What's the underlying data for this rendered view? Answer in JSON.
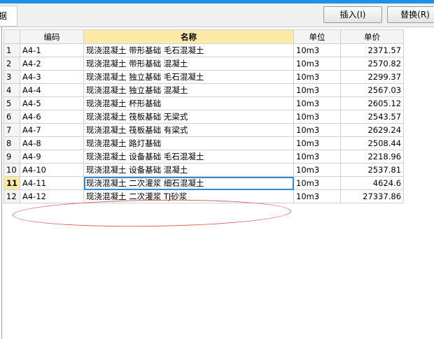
{
  "toolbar": {
    "partial_tab": "据",
    "insert_label": "插入(I)",
    "replace_label": "替换(R)"
  },
  "grid": {
    "columns": [
      "",
      "编码",
      "名称",
      "单位",
      "单价"
    ],
    "selected_row": 11,
    "rows": [
      {
        "num": "1",
        "code": "A4-1",
        "name": "现浇混凝土 带形基础 毛石混凝土",
        "unit": "10m3",
        "price": "2371.57"
      },
      {
        "num": "2",
        "code": "A4-2",
        "name": "现浇混凝土 带形基础 混凝土",
        "unit": "10m3",
        "price": "2570.82"
      },
      {
        "num": "3",
        "code": "A4-3",
        "name": "现浇混凝土 独立基础 毛石混凝土",
        "unit": "10m3",
        "price": "2299.37"
      },
      {
        "num": "4",
        "code": "A4-4",
        "name": "现浇混凝土 独立基础 混凝土",
        "unit": "10m3",
        "price": "2567.03"
      },
      {
        "num": "5",
        "code": "A4-5",
        "name": "现浇混凝土 杯形基础",
        "unit": "10m3",
        "price": "2605.12"
      },
      {
        "num": "6",
        "code": "A4-6",
        "name": "现浇混凝土 筏板基础 无梁式",
        "unit": "10m3",
        "price": "2543.57"
      },
      {
        "num": "7",
        "code": "A4-7",
        "name": "现浇混凝土 筏板基础 有梁式",
        "unit": "10m3",
        "price": "2629.24"
      },
      {
        "num": "8",
        "code": "A4-8",
        "name": "现浇混凝土 路灯基础",
        "unit": "10m3",
        "price": "2508.44"
      },
      {
        "num": "9",
        "code": "A4-9",
        "name": "现浇混凝土 设备基础 毛石混凝土",
        "unit": "10m3",
        "price": "2218.96"
      },
      {
        "num": "10",
        "code": "A4-10",
        "name": "现浇混凝土 设备基础 混凝土",
        "unit": "10m3",
        "price": "2537.81"
      },
      {
        "num": "11",
        "code": "A4-11",
        "name": "现浇混凝土 二次灌浆 细石混凝土",
        "unit": "10m3",
        "price": "4624.6"
      },
      {
        "num": "12",
        "code": "A4-12",
        "name": "现浇混凝土 二次灌浆 TJ砂浆",
        "unit": "10m3",
        "price": "27337.86"
      }
    ]
  }
}
